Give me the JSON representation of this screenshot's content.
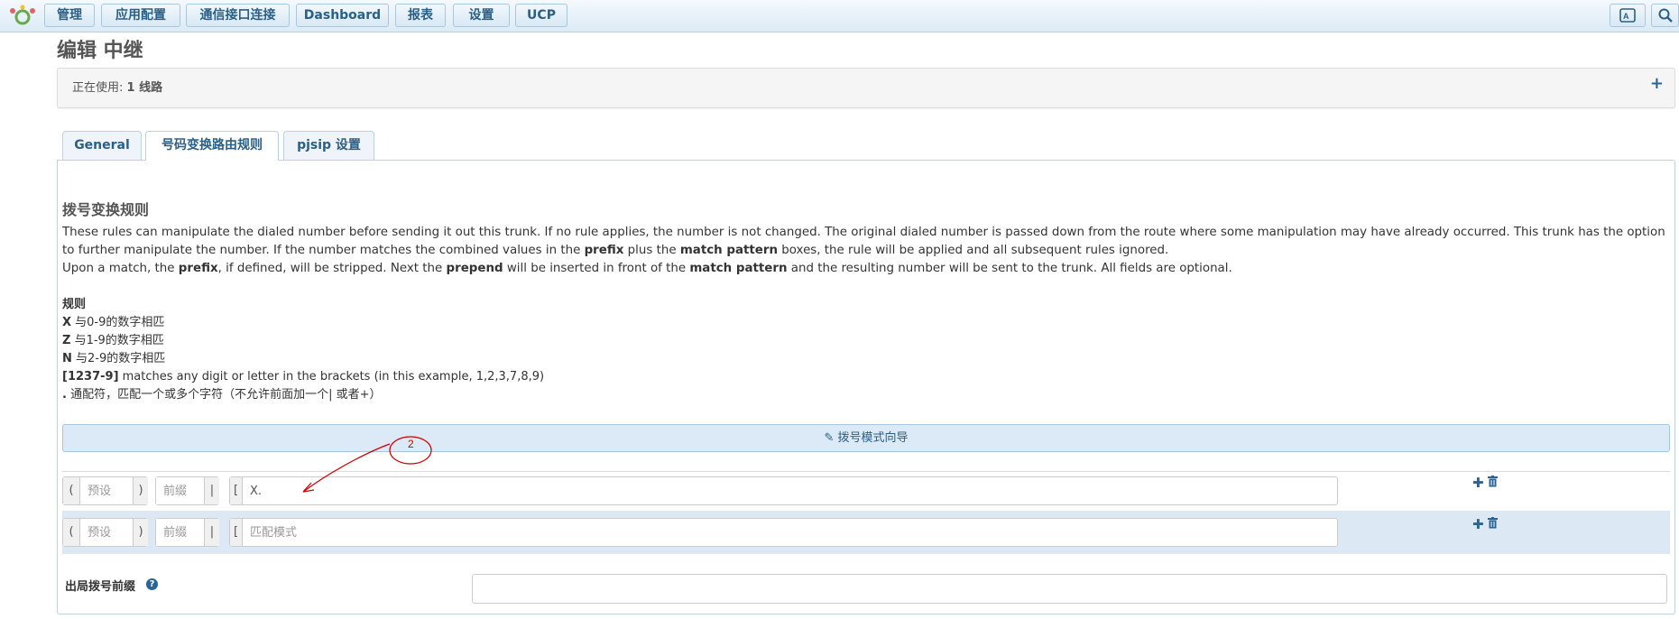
{
  "navbar": {
    "items": [
      "管理",
      "应用配置",
      "通信接口连接",
      "Dashboard",
      "报表",
      "设置",
      "UCP"
    ],
    "translate_icon": "translate-icon",
    "search_icon": "search-icon"
  },
  "page_title": "编辑 中继",
  "in_use": {
    "label": "正在使用:",
    "value": "1 线路",
    "plus": "+"
  },
  "tabs": [
    "General",
    "号码变换路由规则",
    "pjsip 设置"
  ],
  "section_title": "拨号变换规则",
  "description": {
    "line1_a": "These rules can manipulate the dialed number before sending it out this trunk. If no rule applies, the number is not changed. The original dialed number is passed down from the route where some manipulation may have already occurred. This trunk has the option to further manipulate the number. If the number matches the combined values in the ",
    "prefix": "prefix",
    "line1_b": " plus the ",
    "match_pattern": "match pattern",
    "line1_c": " boxes, the rule will be applied and all subsequent rules ignored.",
    "line2_a": "Upon a match, the ",
    "line2_b": ", if defined, will be stripped. Next the ",
    "prepend": "prepend",
    "line2_c": " will be inserted in front of the ",
    "line2_d": " and the resulting number will be sent to the trunk. All fields are optional."
  },
  "rules": {
    "title": "规则",
    "items": [
      {
        "key": "X",
        "text": " 与0-9的数字相匹"
      },
      {
        "key": "Z",
        "text": " 与1-9的数字相匹"
      },
      {
        "key": "N",
        "text": " 与2-9的数字相匹"
      },
      {
        "key": "[1237-9]",
        "text": " matches any digit or letter in the brackets (in this example, 1,2,3,7,8,9)"
      },
      {
        "key": ".",
        "text": " 通配符，匹配一个或多个字符（不允许前面加一个| 或者+）"
      }
    ]
  },
  "wizard_label": "拨号模式向导",
  "pattern_rows": [
    {
      "prepend_placeholder": "预设",
      "prefix_placeholder": "前缀",
      "match_value": "X.",
      "match_placeholder": "匹配模式"
    },
    {
      "prepend_placeholder": "预设",
      "prefix_placeholder": "前缀",
      "match_value": "",
      "match_placeholder": "匹配模式"
    }
  ],
  "addons": {
    "open_paren": "(",
    "close_paren": ")",
    "pipe": "|",
    "open_bracket": "["
  },
  "outbound_prefix_label": "出局拨号前缀",
  "outbound_prefix_value": "",
  "annotation_number": "2",
  "colors": {
    "accent": "#2a6496",
    "annotation": "#cc0000",
    "row_highlight": "#dce9f5"
  }
}
